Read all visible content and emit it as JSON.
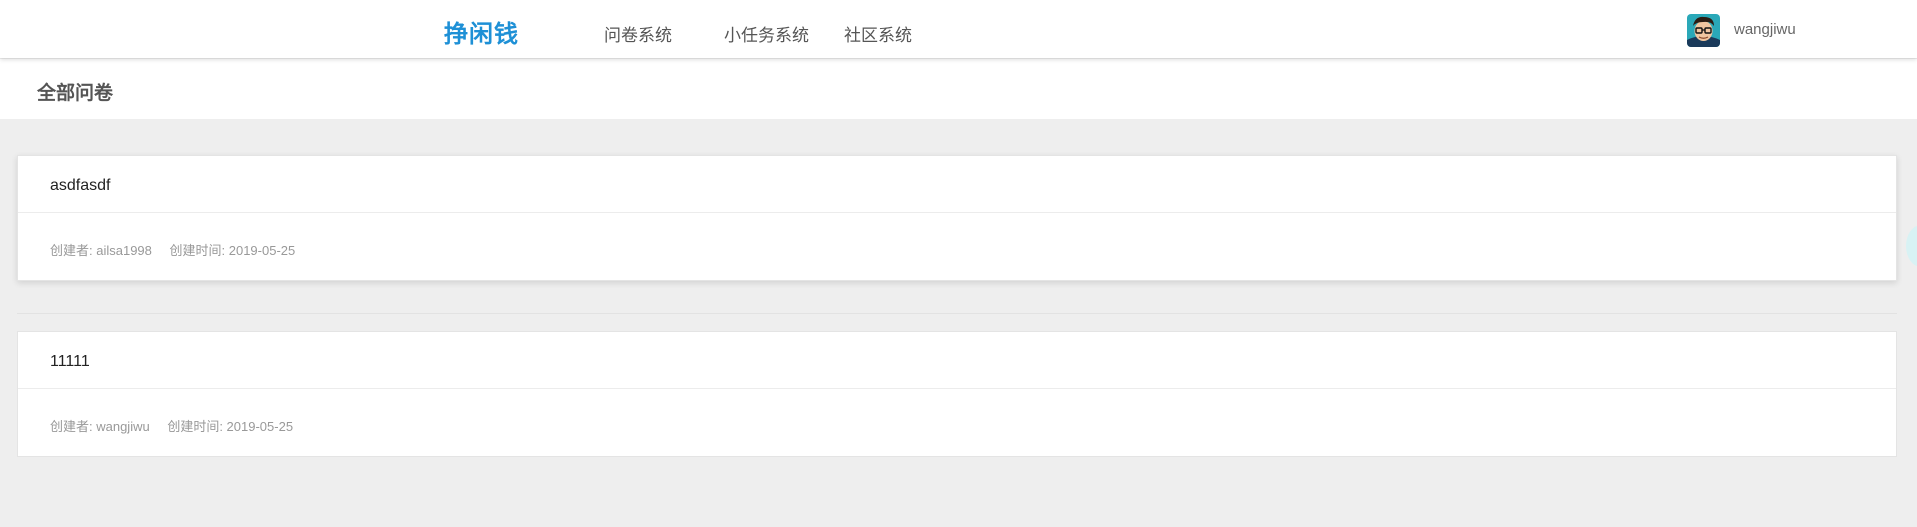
{
  "header": {
    "brand": "挣闲钱",
    "nav": [
      {
        "label": "问卷系统"
      },
      {
        "label": "小任务系统"
      },
      {
        "label": "社区系统"
      }
    ],
    "user": {
      "name": "wangjiwu"
    }
  },
  "page": {
    "title": "全部问卷"
  },
  "surveys": [
    {
      "title": "asdfasdf",
      "creator": "创建者: ailsa1998",
      "created": "创建时间: 2019-05-25"
    },
    {
      "title": "11111",
      "creator": "创建者: wangjiwu",
      "created": "创建时间: 2019-05-25"
    }
  ],
  "colors": {
    "brand": "#1e90d6",
    "background": "#eeeeee"
  }
}
